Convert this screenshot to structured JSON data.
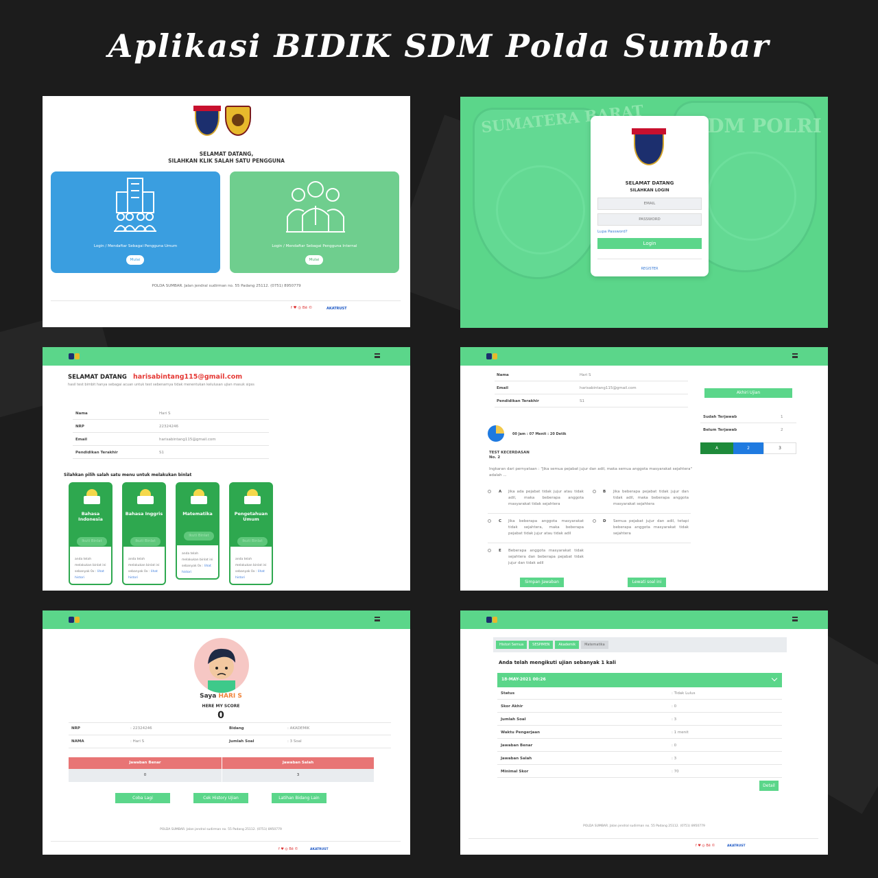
{
  "header": {
    "title": "Aplikasi BIDIK SDM Polda Sumbar"
  },
  "p1": {
    "welcome_line1": "SELAMAT DATANG,",
    "welcome_line2": "SILAHKAN KLIK SALAH SATU PENGGUNA",
    "card_umum_label": "Login / Mendaftar Sebagai Pengguna Umum",
    "card_internal_label": "Login / Mendaftar Sebagai Pengguna Internal",
    "mulai": "Mulai",
    "footer_address": "POLDA SUMBAR. Jalan jendral sudirman no. 55 Padang 25112. (0751) 8950779",
    "social": "f  ♥  ◎  Bē  ©",
    "brand": "AKATRUST",
    "colors": {
      "blue": "#3a9ee0",
      "green": "#6fce8e"
    }
  },
  "p2": {
    "bg_left_text": "SUMATERA BARAT",
    "bg_right_text": "SDM POLRI",
    "welcome": "SELAMAT DATANG",
    "sub": "SILAHKAN LOGIN",
    "email_ph": "EMAIL",
    "password_ph": "PASSWORD",
    "forgot": "Lupa Password?",
    "login": "Login",
    "register": "REGISTER"
  },
  "p3": {
    "greeting": "SELAMAT DATANG",
    "email": "harisabintang115@gmail.com",
    "note": "hasil test bimbit hanya sebagai acuan untuk test sebenarnya tidak menentukan kelulusan ujian masuk sipss",
    "info": [
      {
        "label": "Nama",
        "value": "Hari S"
      },
      {
        "label": "NRP",
        "value": "22324246"
      },
      {
        "label": "Email",
        "value": "harisabintang115@gmail.com"
      },
      {
        "label": "Pendidikan Terakhir",
        "value": "S1"
      }
    ],
    "menu_prompt": "Silahkan pilih salah satu menu untuk melakukan binlat",
    "cards": [
      {
        "title": "Bahasa Indonesia",
        "btn": "Ikuti Binlat",
        "text": "anda telah melakukan binlat ini sebanyak 0x :",
        "link": "lihat histori"
      },
      {
        "title": "Bahasa Inggris",
        "btn": "Ikuti Binlat",
        "text": "anda telah melakukan binlat ini sebanyak 0x :",
        "link": "lihat histori"
      },
      {
        "title": "Matematika",
        "btn": "Ikuti Binlat",
        "text": "anda telah melakukan binlat ini sebanyak 0x :",
        "link": "lihat histori"
      },
      {
        "title": "Pengetahuan Umum",
        "btn": "Ikuti Binlat",
        "text": "anda telah melakukan binlat ini sebanyak 0x :",
        "link": "lihat histori"
      }
    ]
  },
  "p4": {
    "info": [
      {
        "label": "Nama",
        "value": "Hari S"
      },
      {
        "label": "Email",
        "value": "harisabintang115@gmail.com"
      },
      {
        "label": "Pendidikan Terakhir",
        "value": "S1"
      }
    ],
    "end_btn": "Akhiri Ujian",
    "answered_label": "Sudah Terjawab",
    "answered_value": "1",
    "unanswered_label": "Belum Terjawab",
    "unanswered_value": "2",
    "nav": [
      "A",
      "2",
      "3"
    ],
    "timer": "00 Jam : 07 Menit : 20 Detik",
    "test_name": "TEST KECERDASAN",
    "question_no": "No. 2",
    "question": "Ingkaran dari pernyataan : \"Jika semua pejabat jujur dan adil, maka semua anggota masyarakat sejahtera\" adalah ...",
    "options": [
      {
        "key": "A",
        "text": "Jika ada pejabat tidak jujur atau tidak adil, maka beberapa anggota masyarakat tidak sejahtera"
      },
      {
        "key": "B",
        "text": "Jika beberapa pejabat tidak jujur dan tidak adil, maka beberapa anggota masyarakat sejahtera"
      },
      {
        "key": "C",
        "text": "Jika beberapa anggota masyarakat tidak sejahtera, maka beberapa pejabat tidak jujur atau tidak adil"
      },
      {
        "key": "D",
        "text": "Semua pejabat jujur dan adil, tetapi beberapa anggota masyarakat tidak sejahtera"
      },
      {
        "key": "E",
        "text": "Beberapa anggota masyarakat tidak sejahtera dan beberapa pejabat tidak jujur dan tidak adil"
      }
    ],
    "save_btn": "Simpan Jawaban",
    "skip_btn": "Lewati soal ini"
  },
  "p5": {
    "saya": "Saya",
    "name": "HARI S",
    "score_label": "HERE MY SCORE",
    "score": "0",
    "nrp_label": "NRP",
    "nrp_value": ": 22324246",
    "nama_label": "NAMA",
    "nama_value": ": Hari S",
    "bidang_label": "Bidang",
    "bidang_value": ": AKADEMIK",
    "jumlah_label": "Jumlah Soal",
    "jumlah_value": ": 3 Soal",
    "benar_label": "Jawaban Benar",
    "salah_label": "Jawaban Salah",
    "benar_value": "0",
    "salah_value": "3",
    "btn_coba": "Coba Lagi",
    "btn_history": "Cek History Ujian",
    "btn_latihan": "Latihan Bidang Lain",
    "footer": "POLDA SUMBAR. Jalan jendral sudirman no. 55 Padang 25112. (0751) 8950779",
    "social": "f  ♥  ◎  Bē  ©",
    "brand": "AKATRUST"
  },
  "p6": {
    "crumbs": [
      "Histori Semua",
      "SESPIMEN",
      "Akademik",
      "Matematika"
    ],
    "summary": "Anda telah mengikuti ujian sebanyak 1 kali",
    "date": "18-MAY-2021 00:26",
    "rows": [
      {
        "label": "Status",
        "value": ": Tidak Lulus"
      },
      {
        "label": "Skor Akhir",
        "value": ": 0"
      },
      {
        "label": "Jumlah Soal",
        "value": ": 3"
      },
      {
        "label": "Waktu Pengerjaan",
        "value": ": 1 menit"
      },
      {
        "label": "Jawaban Benar",
        "value": ": 0"
      },
      {
        "label": "Jawaban Salah",
        "value": ": 3"
      },
      {
        "label": "Minimal Skor",
        "value": ": 70"
      }
    ],
    "detail_btn": "Detail",
    "footer": "POLDA SUMBAR. Jalan jendral sudirman no. 55 Padang 25112. (0751) 8950779",
    "social": "f  ♥  ◎  Bē  ©",
    "brand": "AKATRUST"
  }
}
